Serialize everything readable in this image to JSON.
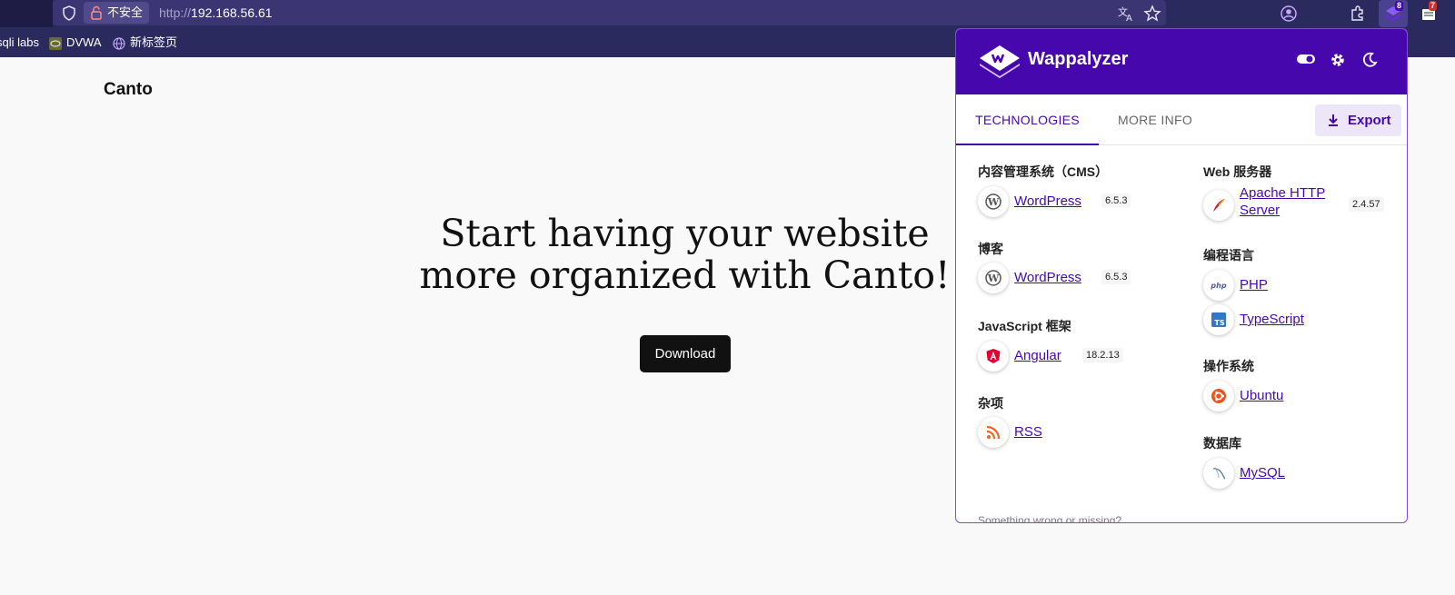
{
  "browser": {
    "insecure_label": "不安全",
    "url_proto": "http://",
    "url_host": "192.168.56.61",
    "ext_badge_count": "8",
    "mail_badge_count": "7",
    "bookmarks": [
      {
        "label": "sqli labs"
      },
      {
        "label": "DVWA"
      },
      {
        "label": "新标签页"
      }
    ]
  },
  "page": {
    "brand": "Canto",
    "hero_line1": "Start having your website",
    "hero_line2": "more organized with Canto!",
    "download_label": "Download"
  },
  "wappalyzer": {
    "title": "Wappalyzer",
    "tabs": [
      {
        "label": "TECHNOLOGIES"
      },
      {
        "label": "MORE INFO"
      }
    ],
    "export_label": "Export",
    "left_column": [
      {
        "category": "内容管理系统（CMS）",
        "techs": [
          {
            "name": "WordPress",
            "version": "6.5.3",
            "icon": "wordpress-icon"
          }
        ]
      },
      {
        "category": "博客",
        "techs": [
          {
            "name": "WordPress",
            "version": "6.5.3",
            "icon": "wordpress-icon"
          }
        ]
      },
      {
        "category": "JavaScript 框架",
        "techs": [
          {
            "name": "Angular",
            "version": "18.2.13",
            "icon": "angular-icon"
          }
        ]
      },
      {
        "category": "杂项",
        "techs": [
          {
            "name": "RSS",
            "version": "",
            "icon": "rss-icon"
          }
        ]
      }
    ],
    "right_column": [
      {
        "category": "Web 服务器",
        "techs": [
          {
            "name_line1": "Apache HTTP",
            "name_line2": "Server",
            "version": "2.4.57",
            "icon": "apache-icon"
          }
        ]
      },
      {
        "category": "编程语言",
        "techs": [
          {
            "name": "PHP",
            "icon": "php-icon"
          },
          {
            "name": "TypeScript",
            "icon": "typescript-icon"
          }
        ]
      },
      {
        "category": "操作系统",
        "techs": [
          {
            "name": "Ubuntu",
            "icon": "ubuntu-icon"
          }
        ]
      },
      {
        "category": "数据库",
        "techs": [
          {
            "name": "MySQL",
            "icon": "mysql-icon"
          }
        ]
      }
    ],
    "footer_partial": "Something wrong or missing?"
  },
  "colors": {
    "wappalyzer_purple": "#4608ad",
    "chrome_bg": "#2b2a5e"
  }
}
